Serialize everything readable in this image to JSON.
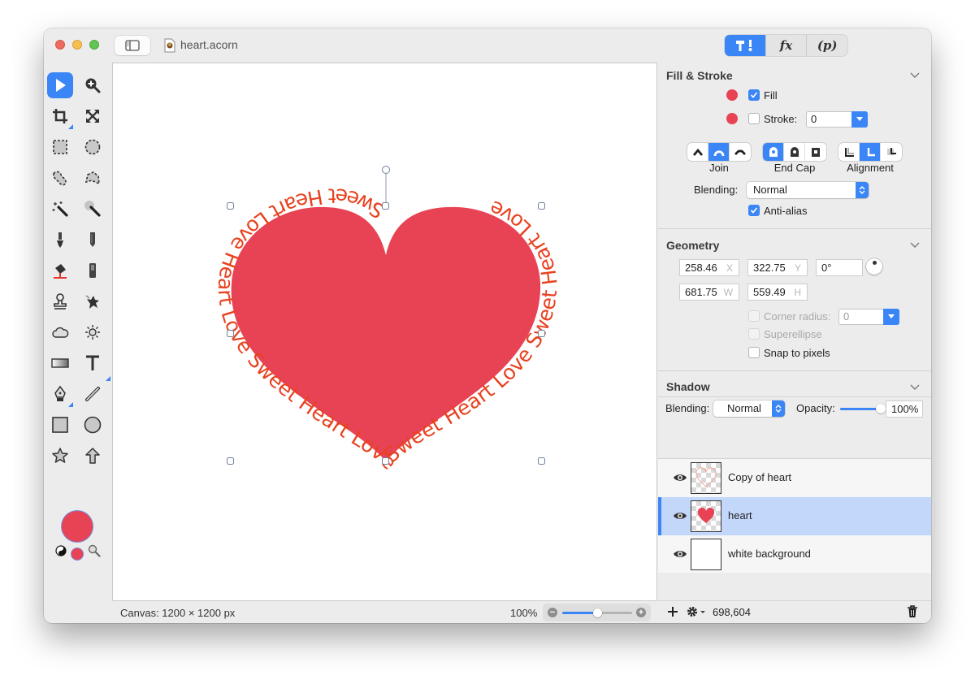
{
  "window": {
    "title": "heart.acorn",
    "inspector_tabs": [
      {
        "label": "tools-icon",
        "icon": "hammer-brush-icon",
        "active": true
      },
      {
        "label": "fx",
        "active": false
      },
      {
        "label": "(p)",
        "active": false
      }
    ]
  },
  "toolbox": {
    "tools": [
      "move-tool",
      "zoom-tool",
      "crop-tool",
      "transform-tool",
      "rect-select-tool",
      "ellipse-select-tool",
      "lasso-tool",
      "polygon-lasso-tool",
      "magic-wand-tool",
      "instant-alpha-tool",
      "brush-tool",
      "pencil-tool",
      "paint-bucket-tool",
      "eraser-tool",
      "clone-tool",
      "smudge-tool",
      "burn-tool",
      "dodge-tool",
      "gradient-tool",
      "text-tool",
      "bezier-pen-tool",
      "line-tool",
      "rectangle-shape-tool",
      "oval-shape-tool",
      "star-shape-tool",
      "arrow-shape-tool"
    ],
    "foreground_color": "#e84355",
    "background_color": "#e84355"
  },
  "canvas": {
    "heart_color": "#e84355",
    "text_color": "#e8411f",
    "path_text": "Sweet Heart Love Heart Love Sweet Heart Love Sweet Heart Love Sweet Heart Love "
  },
  "statusbar": {
    "canvas_size": "Canvas: 1200 × 1200 px",
    "zoom_level": "100%",
    "zoom_slider_fraction": 0.5
  },
  "fill_stroke": {
    "title": "Fill & Stroke",
    "fill_label": "Fill",
    "fill_checked": true,
    "stroke_label": "Stroke:",
    "stroke_checked": false,
    "stroke_value": "0",
    "join_label": "Join",
    "endcap_label": "End Cap",
    "alignment_label": "Alignment",
    "blending_label": "Blending:",
    "blending_value": "Normal",
    "antialias_label": "Anti-alias",
    "antialias_checked": true
  },
  "geometry": {
    "title": "Geometry",
    "x": "258.46",
    "x_unit": "X",
    "y": "322.75",
    "y_unit": "Y",
    "angle": "0°",
    "w": "681.75",
    "w_unit": "W",
    "h": "559.49",
    "h_unit": "H",
    "corner_radius_label": "Corner radius:",
    "corner_radius_value": "0",
    "superellipse_label": "Superellipse",
    "snap_label": "Snap to pixels"
  },
  "shadow": {
    "title": "Shadow",
    "blending_label": "Blending:",
    "blending_value": "Normal",
    "opacity_label": "Opacity:",
    "opacity_value": "100%",
    "opacity_fraction": 1.0
  },
  "layers": [
    {
      "name": "Copy of heart",
      "selected": false
    },
    {
      "name": "heart",
      "selected": true
    },
    {
      "name": "white background",
      "selected": false
    }
  ],
  "panel_footer": {
    "coords": "698,604"
  }
}
